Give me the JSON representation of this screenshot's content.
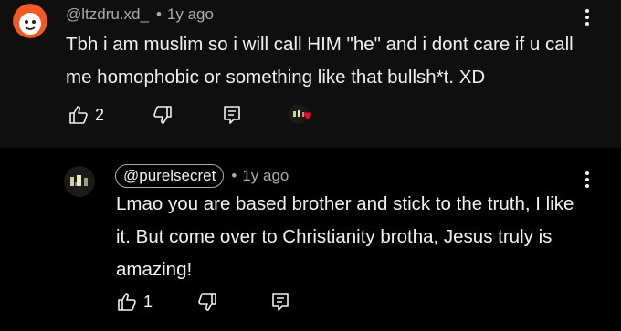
{
  "comment1": {
    "handle": "@ltzdru.xd_",
    "time": "1y ago",
    "text": "Tbh i am muslim so i will call HIM \"he\" and i dont care if u call me homophobic or something like that bullsh*t. XD",
    "like_count": "2",
    "icons": {
      "avatar": "orange-cartoon-avatar",
      "like": "thumb-up-icon",
      "dislike": "thumb-down-icon",
      "reply": "reply-icon",
      "more": "more-vert-icon",
      "heart": "heart-icon"
    },
    "heart_color": "#ff0033"
  },
  "comment2": {
    "handle": "@purelsecret",
    "time": "1y ago",
    "text": "Lmao you are based brother and stick to the truth, I like it. But come over to Christianity brotha, Jesus truly is amazing!",
    "like_count": "1",
    "icons": {
      "avatar": "dark-avatar",
      "like": "thumb-up-icon",
      "dislike": "thumb-down-icon",
      "reply": "reply-icon",
      "more": "more-vert-icon"
    }
  },
  "colors": {
    "background": "#0f0f0f",
    "reply_background": "#000000",
    "text": "#f1f1f1",
    "meta": "#aaaaaa"
  }
}
